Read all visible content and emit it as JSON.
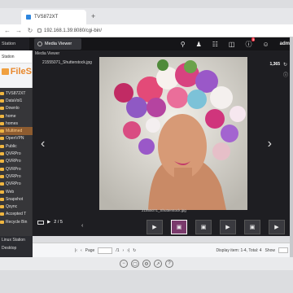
{
  "browser": {
    "tab_title": "TVS872XT",
    "new_tab": "+",
    "url": "192.168.1.39:8080/cgi-bin/"
  },
  "qts": {
    "station_tab": "Station",
    "media_viewer_tab": "Media Viewer",
    "notification_count": "5",
    "user": "adm"
  },
  "sidebar": {
    "top_label": "Station",
    "app_title": "FileS",
    "tree": [
      {
        "label": "TVS872XT",
        "selected": false
      },
      {
        "label": "DataVol1",
        "selected": false
      },
      {
        "label": "Downlo",
        "selected": false
      },
      {
        "label": "home",
        "selected": false
      },
      {
        "label": "homes",
        "selected": false
      },
      {
        "label": "Multimed",
        "selected": true
      },
      {
        "label": "OpenVPN",
        "selected": false
      },
      {
        "label": "Public",
        "selected": false
      },
      {
        "label": "QVRPro",
        "selected": false
      },
      {
        "label": "QVRPro",
        "selected": false
      },
      {
        "label": "QVRPro",
        "selected": false
      },
      {
        "label": "QVRPro",
        "selected": false
      },
      {
        "label": "QVRPro",
        "selected": false
      },
      {
        "label": "Web",
        "selected": false
      },
      {
        "label": "Snapshot",
        "selected": false
      },
      {
        "label": "Qsync",
        "selected": false
      },
      {
        "label": "Accepted T",
        "selected": false
      },
      {
        "label": "Recycle Bin",
        "selected": false
      }
    ],
    "bottom": [
      "Linux Station",
      "Desktop"
    ]
  },
  "viewer": {
    "title": "Media Viewer",
    "filename": "21555071_Shutterstock.jpg",
    "resolution": "1,365",
    "caption": "21555071_Shutterstock.jpg",
    "counter": "2 / 5",
    "thumbs": [
      {
        "icon": "play-icon",
        "active": false
      },
      {
        "icon": "image-icon",
        "active": true
      },
      {
        "icon": "image-icon",
        "active": false
      },
      {
        "icon": "play-icon",
        "active": false
      },
      {
        "icon": "image-icon",
        "active": false
      },
      {
        "icon": "play-icon",
        "active": false
      }
    ]
  },
  "pager": {
    "page_label": "Page",
    "page_value": "1",
    "of_label": "/1",
    "display_label": "Display item: 1-4, Total: 4",
    "show_label": "Show",
    "show_value": "50"
  },
  "recent": "Recent File"
}
